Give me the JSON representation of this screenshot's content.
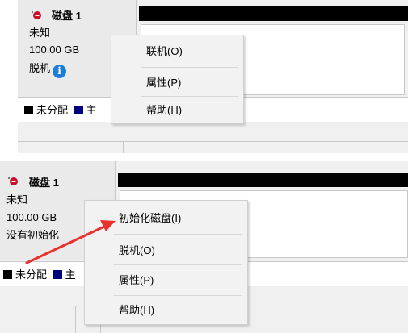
{
  "top": {
    "disk": {
      "name": "磁盘 1",
      "type": "未知",
      "size": "100.00 GB",
      "status": "脱机"
    },
    "legend": {
      "unallocated": "未分配",
      "primary": "主"
    },
    "menu": [
      "联机(O)",
      "属性(P)",
      "帮助(H)"
    ]
  },
  "bottom": {
    "disk": {
      "name": "磁盘 1",
      "type": "未知",
      "size": "100.00 GB",
      "status": "没有初始化"
    },
    "legend": {
      "unallocated": "未分配",
      "primary": "主"
    },
    "menu": [
      "初始化磁盘(I)",
      "脱机(O)",
      "属性(P)",
      "帮助(H)"
    ]
  },
  "colors": {
    "unallocated": "#000000",
    "primary": "#00007f",
    "info_icon": "#1e7ed6",
    "arrow": "#e8322e",
    "disk_icon": "#c8102e"
  },
  "icons": [
    "disk-offline-icon",
    "info-icon",
    "red-arrow"
  ]
}
